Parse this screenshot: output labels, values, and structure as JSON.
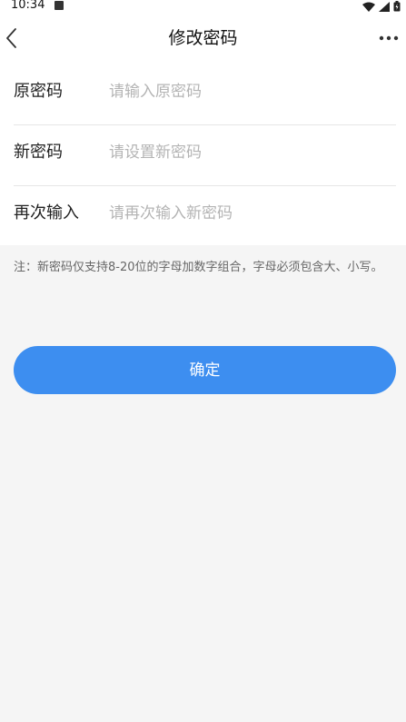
{
  "status_bar": {
    "time": "10:34"
  },
  "header": {
    "title": "修改密码",
    "back_icon": "chevron-left-icon",
    "more_icon": "more-horizontal-icon"
  },
  "form": {
    "rows": [
      {
        "label": "原密码",
        "placeholder": "请输入原密码",
        "value": ""
      },
      {
        "label": "新密码",
        "placeholder": "请设置新密码",
        "value": ""
      },
      {
        "label": "再次输入",
        "placeholder": "请再次输入新密码",
        "value": ""
      }
    ]
  },
  "note": "注：新密码仅支持8-20位的字母加数字组合，字母必须包含大、小写。",
  "actions": {
    "confirm_label": "确定"
  },
  "colors": {
    "accent": "#3d8ef0",
    "background": "#f5f5f5",
    "placeholder": "#b4b4b4"
  }
}
